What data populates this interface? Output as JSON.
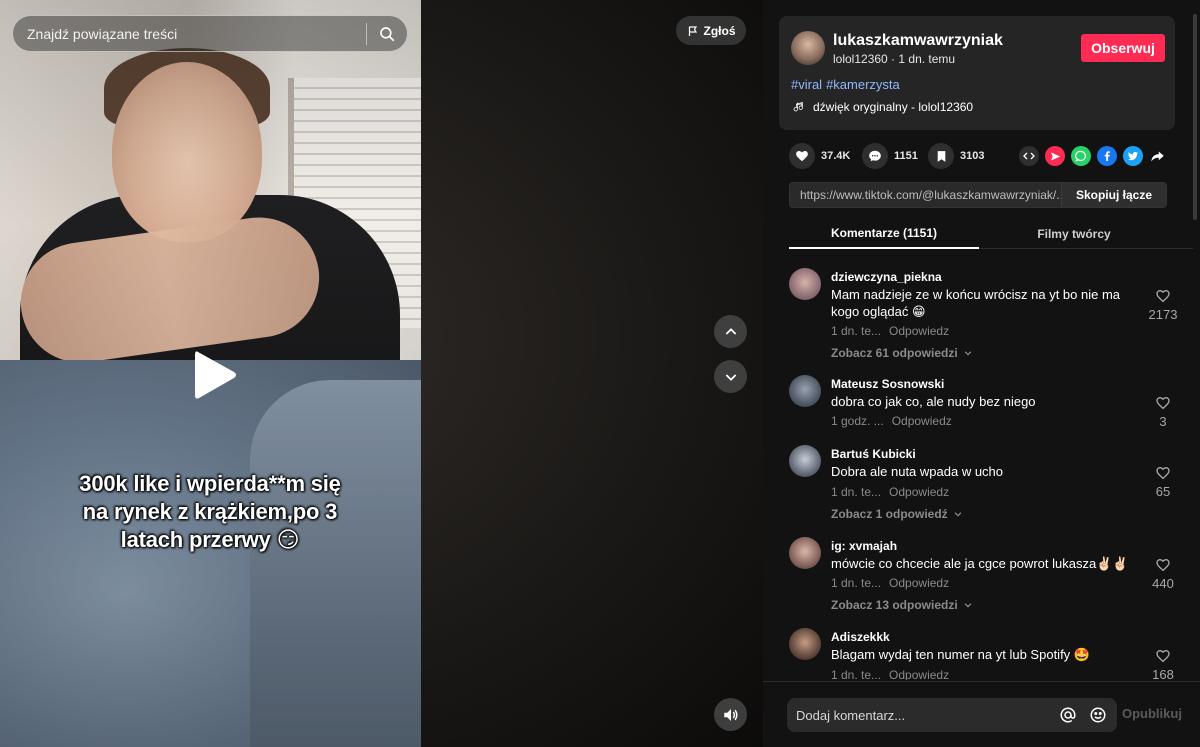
{
  "search": {
    "placeholder": "Znajdź powiązane treści"
  },
  "video": {
    "caption_line1": "300k like i wpierda**m się",
    "caption_line2": "na rynek z krążkiem,po 3",
    "caption_line3": "latach przerwy 😏",
    "report_label": "Zgłoś"
  },
  "author": {
    "username": "lukaszkamwawrzyniak",
    "handle": "lolol12360",
    "separator": " · ",
    "posted": "1 dn. temu",
    "follow_label": "Obserwuj"
  },
  "hashtags": [
    "#viral",
    "#kamerzysta"
  ],
  "sound": {
    "label": "dźwięk oryginalny - lolol12360"
  },
  "stats": {
    "likes": "37.4K",
    "comments": "1151",
    "saves": "3103"
  },
  "share": {
    "link": "https://www.tiktok.com/@lukaszkamwawrzyniak/...",
    "copy_label": "Skopiuj łącze"
  },
  "tabs": [
    {
      "label": "Komentarze (1151)",
      "active": true
    },
    {
      "label": "Filmy twórcy",
      "active": false
    }
  ],
  "comments": [
    {
      "user": "dziewczyna_piekna",
      "text": "Mam nadzieje ze w końcu wrócisz na yt bo nie ma kogo oglądać 😁",
      "time": "1 dn. te...",
      "reply": "Odpowiedz",
      "likes": "2173",
      "replies": "Zobacz 61 odpowiedzi"
    },
    {
      "user": "Mateusz Sosnowski",
      "text": "dobra co jak co, ale nudy bez niego",
      "time": "1 godz. ...",
      "reply": "Odpowiedz",
      "likes": "3",
      "replies": ""
    },
    {
      "user": "Bartuś Kubicki",
      "text": "Dobra ale nuta wpada w ucho",
      "time": "1 dn. te...",
      "reply": "Odpowiedz",
      "likes": "65",
      "replies": "Zobacz 1 odpowiedź"
    },
    {
      "user": "ig: xvmajah",
      "text": "mówcie co chcecie ale ja cgce powrot lukasza✌🏻✌🏻",
      "time": "1 dn. te...",
      "reply": "Odpowiedz",
      "likes": "440",
      "replies": "Zobacz 13 odpowiedzi"
    },
    {
      "user": "Adiszekkk",
      "text": "Blagam wydaj ten numer na yt lub Spotify 🤩",
      "time": "1 dn. te...",
      "reply": "Odpowiedz",
      "likes": "168",
      "replies": ""
    }
  ],
  "comment_box": {
    "placeholder": "Dodaj komentarz...",
    "publish_label": "Opublikuj"
  },
  "colors": {
    "accent": "#fe2c55",
    "hashtag": "#8fb8ff",
    "panel_bg": "#121212",
    "card_bg": "#252525"
  },
  "icons": [
    "search-icon",
    "play-icon",
    "flag-icon",
    "chevron-up-icon",
    "chevron-down-icon",
    "volume-icon",
    "heart-icon",
    "comment-icon",
    "bookmark-icon",
    "embed-icon",
    "send-icon",
    "whatsapp-icon",
    "facebook-icon",
    "twitter-icon",
    "share-arrow-icon",
    "music-note-icon",
    "at-icon",
    "emoji-icon"
  ]
}
